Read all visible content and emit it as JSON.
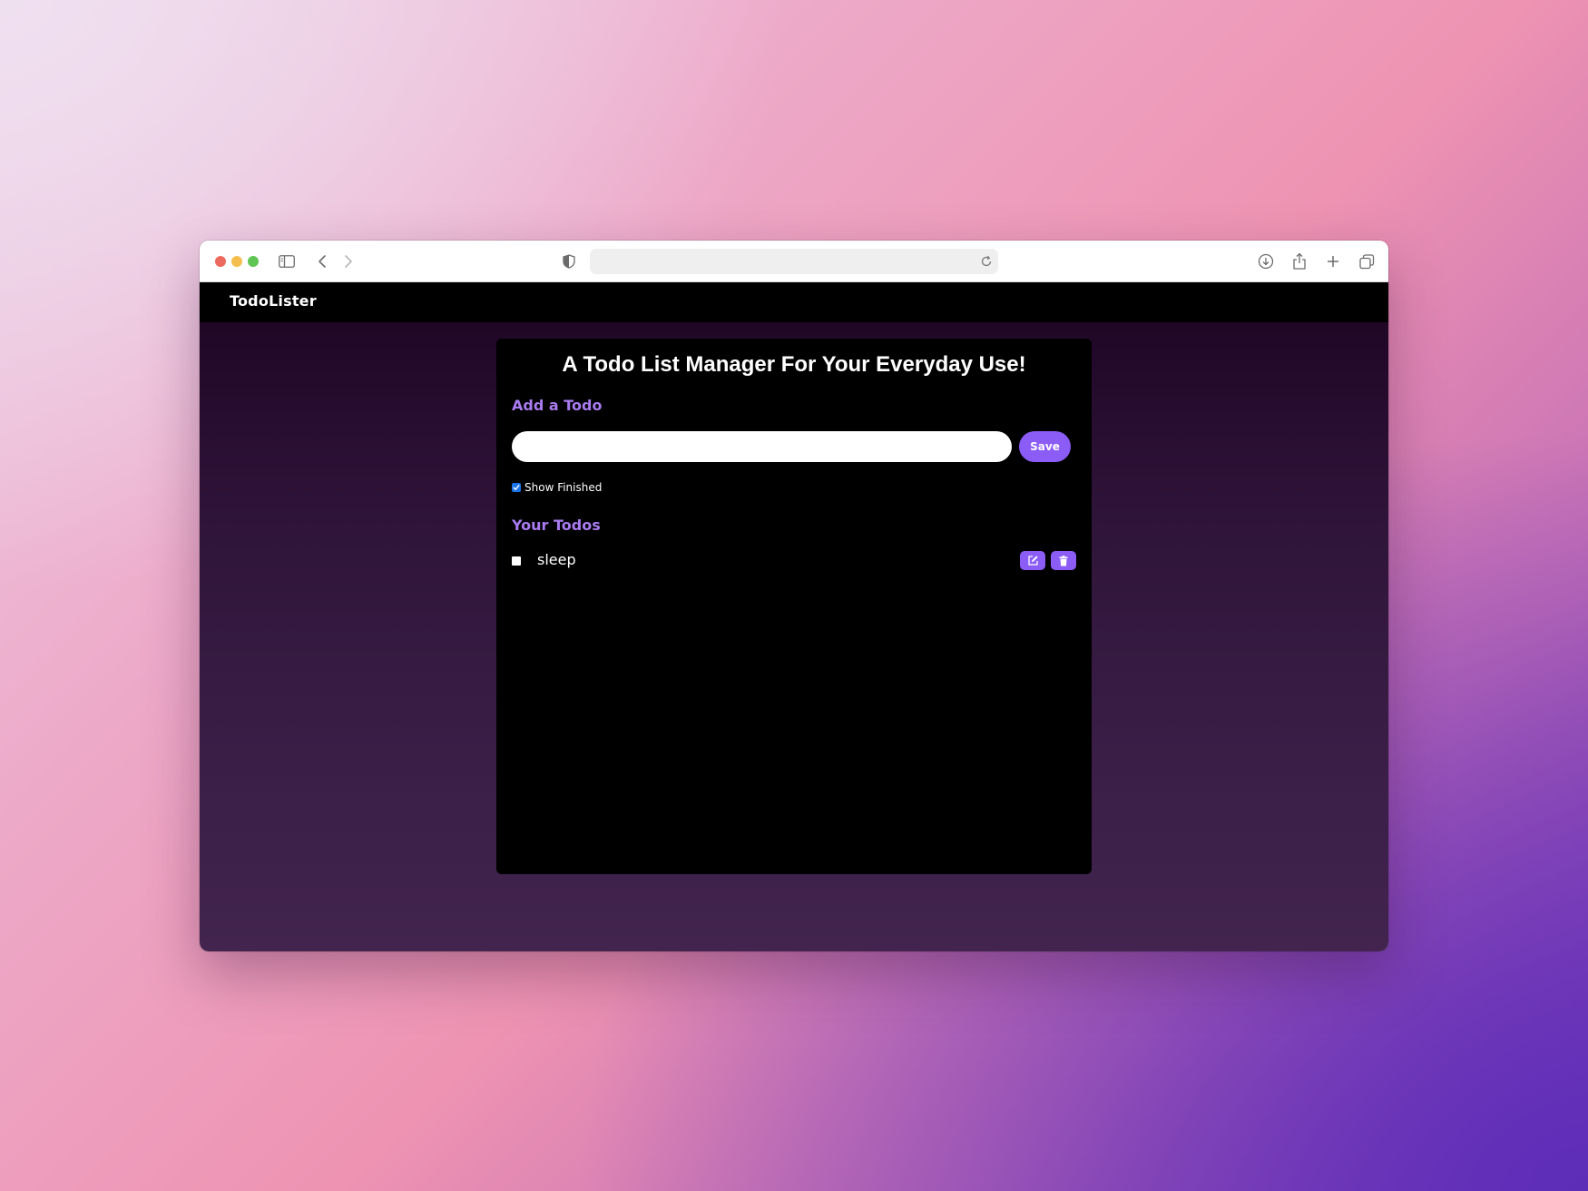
{
  "browser": {
    "url": "",
    "icons": [
      "sidebar-icon",
      "back-icon",
      "forward-icon",
      "shield-icon",
      "reload-icon",
      "download-icon",
      "share-icon",
      "new-tab-icon",
      "tabs-overview-icon"
    ]
  },
  "navbar": {
    "brand": "TodoLister"
  },
  "main": {
    "title": "A Todo List Manager For Your Everyday Use!",
    "add_heading": "Add a Todo",
    "input": {
      "value": "",
      "placeholder": ""
    },
    "save_label": "Save",
    "show_finished": {
      "label": "Show Finished",
      "checked": true
    },
    "todos_heading": "Your Todos",
    "todos": [
      {
        "text": "sleep",
        "done": false
      }
    ]
  },
  "colors": {
    "accent": "#8b5cf6",
    "heading": "#a97bf0",
    "card": "#000000",
    "navbar": "#000000",
    "page_top": "#1c0422",
    "page_bottom": "#42244e"
  }
}
